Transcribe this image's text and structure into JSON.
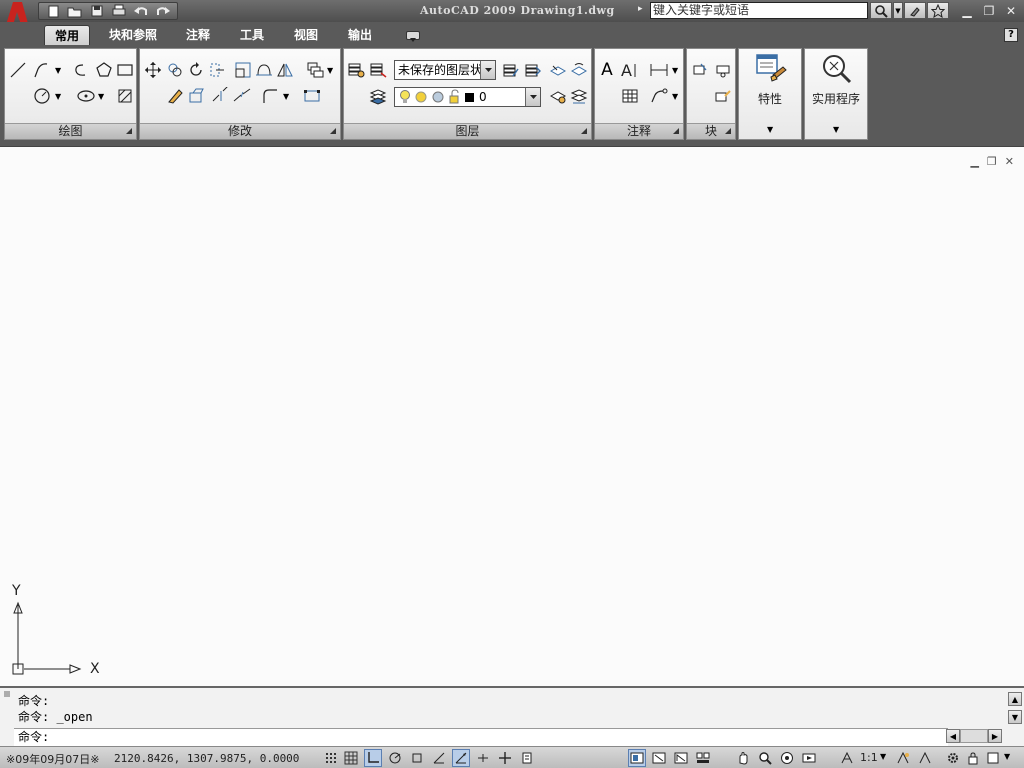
{
  "title_bar": {
    "title": "AutoCAD 2009 Drawing1.dwg",
    "search_placeholder": "键入关键字或短语"
  },
  "tabs": [
    {
      "label": "常用",
      "active": true
    },
    {
      "label": "块和参照"
    },
    {
      "label": "注释"
    },
    {
      "label": "工具"
    },
    {
      "label": "视图"
    },
    {
      "label": "输出"
    }
  ],
  "panels": {
    "draw": "绘图",
    "modify": "修改",
    "layers": "图层",
    "annotation": "注释",
    "block": "块",
    "properties": "特性",
    "utilities": "实用程序"
  },
  "layer_combo": {
    "state_value": "未保存的图层状态",
    "current_layer": "0"
  },
  "ucs": {
    "x_label": "X",
    "y_label": "Y"
  },
  "command": {
    "history": [
      "命令:",
      "命令: _open"
    ],
    "prompt": "命令:"
  },
  "status": {
    "date": "※09年09月07日※",
    "coordinates": "2120.8426,  1307.9875,  0.0000",
    "annotation_scale": "1:1"
  },
  "colors": {
    "frame": "#5a5a5a",
    "ribbon_panel": "#f0f0f0",
    "drawing_bg": "#fbfbfb",
    "logo_red": "#c8231e"
  }
}
